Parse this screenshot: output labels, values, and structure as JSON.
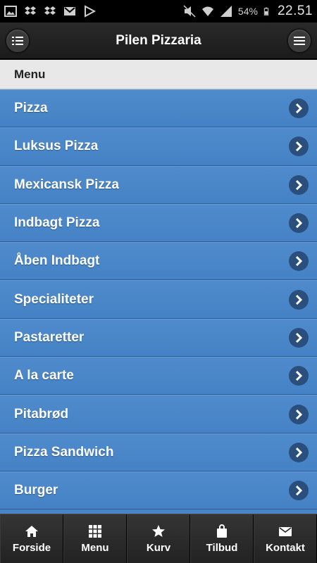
{
  "status_bar": {
    "battery_percent": "54%",
    "time": "22.51"
  },
  "header": {
    "title": "Pilen Pizzaria"
  },
  "section": {
    "label": "Menu"
  },
  "menu": {
    "items": [
      {
        "label": "Pizza"
      },
      {
        "label": "Luksus Pizza"
      },
      {
        "label": "Mexicansk Pizza"
      },
      {
        "label": "Indbagt Pizza"
      },
      {
        "label": "Åben Indbagt"
      },
      {
        "label": "Specialiteter"
      },
      {
        "label": "Pastaretter"
      },
      {
        "label": "A la carte"
      },
      {
        "label": "Pitabrød"
      },
      {
        "label": "Pizza Sandwich"
      },
      {
        "label": "Burger"
      }
    ]
  },
  "navbar": {
    "items": [
      {
        "label": "Forside",
        "icon": "home-icon"
      },
      {
        "label": "Menu",
        "icon": "grid-icon"
      },
      {
        "label": "Kurv",
        "icon": "star-icon"
      },
      {
        "label": "Tilbud",
        "icon": "bag-icon"
      },
      {
        "label": "Kontakt",
        "icon": "mail-icon"
      }
    ]
  }
}
